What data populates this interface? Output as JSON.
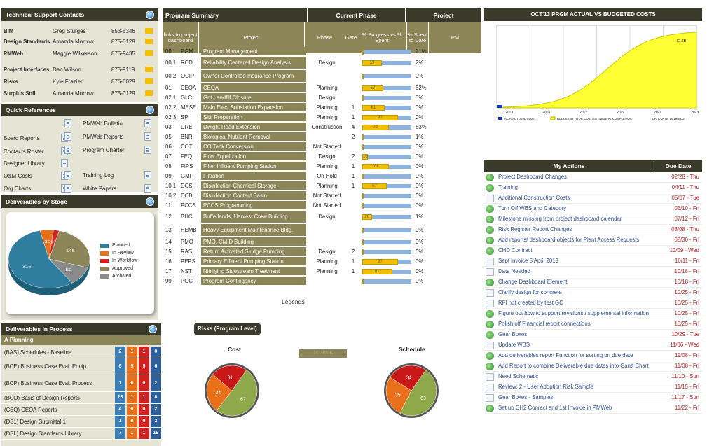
{
  "tech_support": {
    "title": "Technical Support Contacts",
    "rows": [
      {
        "area": "BIM",
        "name": "Greg Sturges",
        "phone": "853-5346"
      },
      {
        "area": "Design Standards",
        "name": "Amanda Morrow",
        "phone": "875-0129"
      },
      {
        "area": "PMWeb",
        "name": "Maggie Wilkerson",
        "phone": "875-9435"
      },
      {
        "area": "Project Interfaces",
        "name": "Dan Wilson",
        "phone": "875-9119"
      },
      {
        "area": "Risks",
        "name": "Kyle Frazier",
        "phone": "876-6029"
      },
      {
        "area": "Surplus Soil",
        "name": "Amanda Morrow",
        "phone": "875-0129"
      }
    ]
  },
  "quick_refs": {
    "title": "Quick References",
    "left": [
      "Board Reports",
      "Contacts Roster",
      "Designer Library",
      "O&M Costs",
      "Org Charts"
    ],
    "right": [
      "PMWeb Bulletin",
      "PMWeb Reports",
      "Program Charter",
      "Training Log",
      "White Papers"
    ]
  },
  "deliverables_stage": {
    "title": "Deliverables by Stage",
    "legend": [
      "Planned",
      "In Review",
      "In Workflow",
      "Approved",
      "Archived"
    ],
    "colors": [
      "#2f7ea0",
      "#e8701a",
      "#d02020",
      "#8b8558",
      "#8a8a8a"
    ],
    "values": [
      316,
      30,
      13,
      145,
      59
    ],
    "labels": [
      "316",
      "30",
      "13",
      "145",
      "59"
    ]
  },
  "deliverables_process": {
    "title": "Deliverables in Process",
    "group": "A Planning",
    "rows": [
      {
        "name": "(BAS) Schedules - Baseline",
        "v": [
          "2",
          "1",
          "1",
          "0"
        ]
      },
      {
        "name": "(BCE) Business Case Eval. Equip",
        "v": [
          "6",
          "5",
          "5",
          "6"
        ]
      },
      {
        "name": "(BCP) Business Case Eval. Process",
        "v": [
          "1",
          "0",
          "0",
          "2"
        ]
      },
      {
        "name": "(BOD) Basis of Design Reports",
        "v": [
          "23",
          "1",
          "1",
          "8"
        ]
      },
      {
        "name": "(CEQ) CEQA Reports",
        "v": [
          "4",
          "0",
          "0",
          "2"
        ]
      },
      {
        "name": "(DS1) Design Submittal 1",
        "v": [
          "1",
          "0",
          "0",
          "2"
        ]
      },
      {
        "name": "(DSL) Design Standards Library",
        "v": [
          "7",
          "1",
          "1",
          "19"
        ]
      }
    ]
  },
  "program_summary": {
    "title": "Program Summary",
    "current_phase": "Current Phase",
    "project_hdr": "Project",
    "cols": [
      "links to project dashboard",
      "Project",
      "Phase",
      "Gate",
      "% Progress vs % Spent",
      "% Spent to Date",
      "PM"
    ],
    "rows": [
      {
        "num": "00",
        "code": "PGM",
        "name": "Program Management",
        "phase": "",
        "gate": "",
        "prog": 0,
        "spent": "21%"
      },
      {
        "num": "00.1",
        "code": "RCD",
        "name": "Reliability Centered Design Analysis",
        "phase": "Design",
        "gate": "",
        "prog": 53,
        "spent": "2%"
      },
      {
        "num": "00.2",
        "code": "OCIP",
        "name": "Owner Controlled Insurance Program",
        "phase": "",
        "gate": "",
        "prog": 0,
        "spent": "0%"
      },
      {
        "num": "01",
        "code": "CEQA",
        "name": "CEQA",
        "phase": "Planning",
        "gate": "",
        "prog": 57,
        "spent": "52%"
      },
      {
        "num": "02.1",
        "code": "GLC",
        "name": "Grit Landfill Closure",
        "phase": "Design",
        "gate": "",
        "prog": 0,
        "spent": "0%"
      },
      {
        "num": "02.2",
        "code": "MESE",
        "name": "Main Elec. Substation Expansion",
        "phase": "Planning",
        "gate": "1",
        "prog": 61,
        "spent": "0%"
      },
      {
        "num": "02.3",
        "code": "SP",
        "name": "Site Preparation",
        "phase": "Planning",
        "gate": "1",
        "prog": 97,
        "spent": "0%"
      },
      {
        "num": "03",
        "code": "DRE",
        "name": "Dwight Road Extension",
        "phase": "Construction",
        "gate": "4",
        "prog": 72,
        "spent": "83%"
      },
      {
        "num": "05",
        "code": "BNR",
        "name": "Biological Nutrient Removal",
        "phase": "",
        "gate": "2",
        "prog": 0,
        "spent": "1%"
      },
      {
        "num": "06",
        "code": "COT",
        "name": "CO Tank Conversion",
        "phase": "Not Started",
        "gate": "",
        "prog": 0,
        "spent": "0%"
      },
      {
        "num": "07",
        "code": "FEQ",
        "name": "Flow Equalization",
        "phase": "Design",
        "gate": "2",
        "prog": 16,
        "spent": "0%"
      },
      {
        "num": "08",
        "code": "FIPS",
        "name": "Filter Influent Pumping Station",
        "phase": "Planning",
        "gate": "1",
        "prog": 73,
        "spent": "0%"
      },
      {
        "num": "09",
        "code": "GMF",
        "name": "Filtration",
        "phase": "On Hold",
        "gate": "1",
        "prog": 0,
        "spent": "0%"
      },
      {
        "num": "10.1",
        "code": "DCS",
        "name": "Disinfection Chemical Storage",
        "phase": "Planning",
        "gate": "1",
        "prog": 67,
        "spent": "0%"
      },
      {
        "num": "10.2",
        "code": "DCB",
        "name": "Disinfection Contact Basin",
        "phase": "Not Started",
        "gate": "",
        "prog": 0,
        "spent": "0%"
      },
      {
        "num": "11",
        "code": "PCCS",
        "name": "PCCS Programming",
        "phase": "Not Started",
        "gate": "",
        "prog": 0,
        "spent": "0%"
      },
      {
        "num": "12",
        "code": "BHC",
        "name": "Bufferlands, Harvest Crew Building",
        "phase": "Design",
        "gate": "",
        "prog": 26,
        "spent": "1%"
      },
      {
        "num": "13",
        "code": "HEMB",
        "name": "Heavy Equipment Maintenance Bldg.",
        "phase": "",
        "gate": "",
        "prog": 0,
        "spent": "0%"
      },
      {
        "num": "14",
        "code": "PMO",
        "name": "PMO, CMID Building",
        "phase": "",
        "gate": "",
        "prog": 0,
        "spent": "0%"
      },
      {
        "num": "15",
        "code": "RAS",
        "name": "Return Activated Sludge Pumping",
        "phase": "Design",
        "gate": "2",
        "prog": 0,
        "spent": "0%"
      },
      {
        "num": "16",
        "code": "PEPS",
        "name": "Primary Effluent Pumping Station",
        "phase": "Planning",
        "gate": "1",
        "prog": 97,
        "spent": "0%"
      },
      {
        "num": "17",
        "code": "NST",
        "name": "Nitrifying Sidestream Treatment",
        "phase": "Planning",
        "gate": "1",
        "prog": 81,
        "spent": "0%"
      },
      {
        "num": "99",
        "code": "PGC",
        "name": "Program Contingency",
        "phase": "",
        "gate": "",
        "prog": 0,
        "spent": "0%"
      }
    ],
    "legends": "Legends"
  },
  "risks": {
    "title": "Risks (Program Level)",
    "cost_label": "Cost",
    "schedule_label": "Schedule",
    "middle_box": "161.05 K",
    "cost": [
      67,
      34,
      31
    ],
    "schedule": [
      63,
      35,
      34
    ],
    "colors": [
      "#8fa84a",
      "#e8701a",
      "#c81818"
    ]
  },
  "cost_chart": {
    "title": "OCT'13 PRGM ACTUAL VS BUDGETED COSTS",
    "years": [
      "2013",
      "2015",
      "2017",
      "2019",
      "2021",
      "2023"
    ],
    "end_label": "$1.6B",
    "legend_actual": "ACTUAL TOTAL COST",
    "legend_budget": "BUDGETED TOTAL COST/ESTIMATE AT COMPLETION",
    "data_date": "DATA DATE: 10/28/2013"
  },
  "my_actions": {
    "title": "My Actions",
    "due_title": "Due Date",
    "rows": [
      {
        "t": "Project Dashboard Changes",
        "d": "02/28 - Thu",
        "i": "g"
      },
      {
        "t": "Training",
        "d": "04/11 - Thu",
        "i": "g"
      },
      {
        "t": "Additional Construction Costs",
        "d": "05/07 - Tue",
        "i": "p"
      },
      {
        "t": "Turn Off WBS and Category",
        "d": "05/10 - Fri",
        "i": "g"
      },
      {
        "t": "Milestone missing from project dashboard calendar",
        "d": "07/12 - Fri",
        "i": "g"
      },
      {
        "t": "Risk Register Report Changes",
        "d": "08/08 - Thu",
        "i": "g"
      },
      {
        "t": "Add reports/ dashboard objects for Plant Access Requests",
        "d": "08/30 - Fri",
        "i": "g"
      },
      {
        "t": "CHD Contract",
        "d": "10/09 - Wed",
        "i": "g"
      },
      {
        "t": "Sept invoice 5 April 2013",
        "d": "10/11 - Fri",
        "i": "p"
      },
      {
        "t": "Data Needed",
        "d": "10/18 - Fri",
        "i": "p"
      },
      {
        "t": "Change Dashboard Element",
        "d": "10/18 - Fri",
        "i": "g"
      },
      {
        "t": "Clarify design for concrete",
        "d": "10/25 - Fri",
        "i": "p"
      },
      {
        "t": "RFI not created by test GC",
        "d": "10/25 - Fri",
        "i": "p"
      },
      {
        "t": "Figure out how to support revisions / supplemental information",
        "d": "10/25 - Fri",
        "i": "g"
      },
      {
        "t": "Polish off Financial report connections",
        "d": "10/25 - Fri",
        "i": "g"
      },
      {
        "t": "Gear Boxes",
        "d": "10/29 - Tue",
        "i": "g"
      },
      {
        "t": "Update WBS",
        "d": "11/06 - Wed",
        "i": "p"
      },
      {
        "t": "Add deliverables report Function for sorting on due date",
        "d": "11/08 - Fri",
        "i": "g"
      },
      {
        "t": "Add Report to combine Deliverable due dates into Gantt Chart",
        "d": "11/08 - Fri",
        "i": "g"
      },
      {
        "t": "Need Schematic",
        "d": "11/10 - Sun",
        "i": "p"
      },
      {
        "t": "Review: 2 - User Adoption Risk Sample",
        "d": "11/15 - Fri",
        "i": "p"
      },
      {
        "t": "Gear Boxes - Samples",
        "d": "11/17 - Sun",
        "i": "p"
      },
      {
        "t": "Set up CH2 Conract and 1st Invoice in PMWeb",
        "d": "11/22 - Fri",
        "i": "g"
      }
    ]
  }
}
